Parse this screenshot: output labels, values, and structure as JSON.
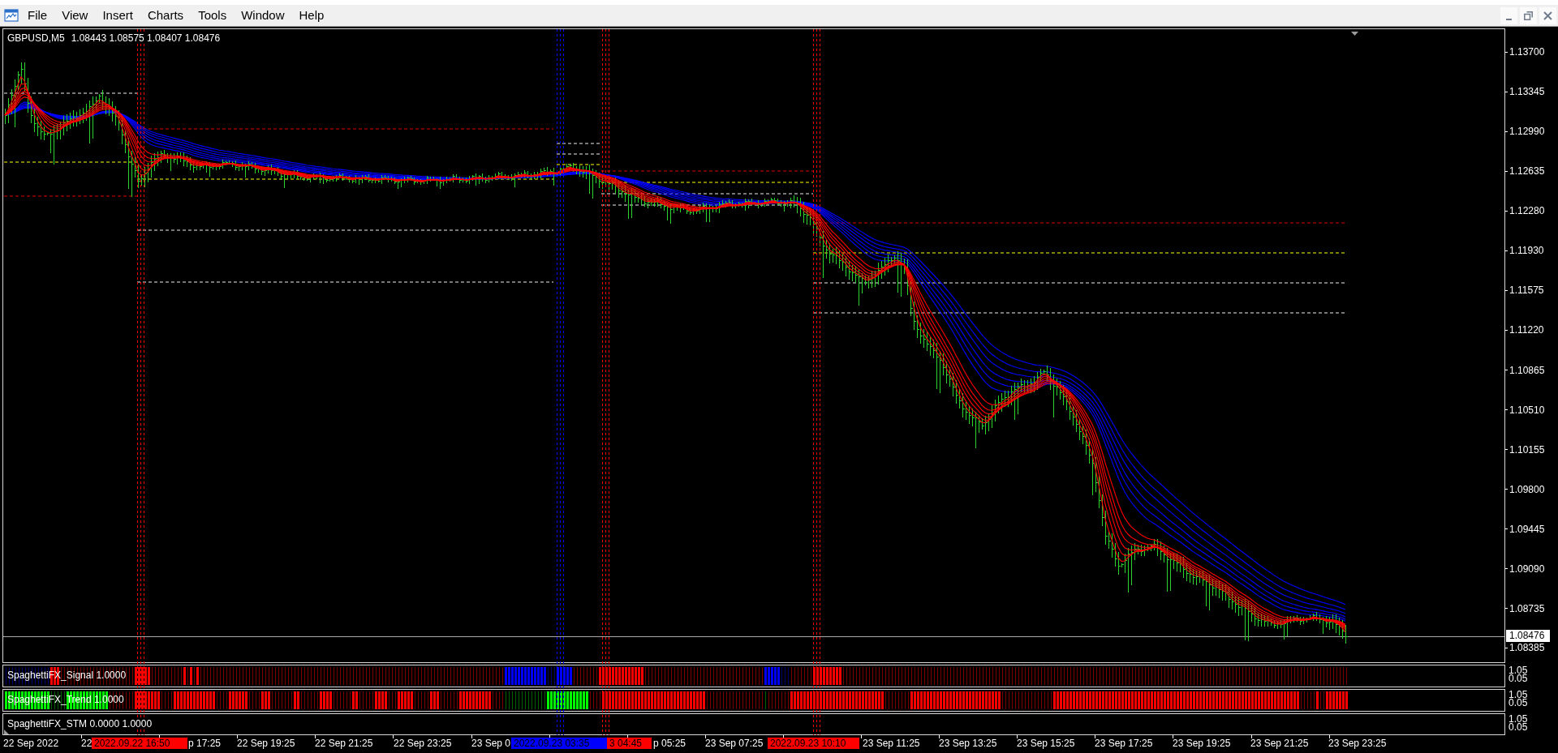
{
  "window": {
    "menu": [
      "File",
      "View",
      "Insert",
      "Charts",
      "Tools",
      "Window",
      "Help"
    ]
  },
  "chart": {
    "symbol": "GBPUSD,M5",
    "quote": "1.08443 1.08575 1.08407 1.08476"
  },
  "price_axis": {
    "ticks": [
      "1.13700",
      "1.13345",
      "1.12990",
      "1.12635",
      "1.12280",
      "1.11930",
      "1.11575",
      "1.11220",
      "1.10865",
      "1.10510",
      "1.10155",
      "1.09800",
      "1.09445",
      "1.09090",
      "1.08735"
    ],
    "current_price": "1.08476",
    "bottom_label": "1.08385"
  },
  "indicators": [
    {
      "kind": "signal",
      "label": "SpaghettiFX_Signal 1.0000",
      "scale": [
        "1.05",
        "0.05"
      ]
    },
    {
      "kind": "trend",
      "label": "SpaghettiFX_Trend 1.0000",
      "scale": [
        "1.05",
        "0.05"
      ]
    },
    {
      "kind": "empty",
      "label": "SpaghettiFX_STM 0.0000 1.0000",
      "scale": [
        "1.05",
        "0.05"
      ]
    }
  ],
  "time_axis": {
    "labels": [
      "22 Sep 2022",
      "22",
      "p 17:25",
      "22 Sep 19:25",
      "22 Sep 21:25",
      "22 Sep 23:25",
      "23 Sep 0",
      "p 05:25",
      "23 Sep 07:25",
      "23 Sep 11:25",
      "23 Sep 13:25",
      "23 Sep 15:25",
      "23 Sep 17:25",
      "23 Sep 19:25",
      "23 Sep 21:25",
      "23 Sep 23:25"
    ]
  },
  "time_markers": [
    {
      "text": "2022.09.22 16:50",
      "color": "#ff0000"
    },
    {
      "text": "2022.09.23 03:35",
      "color": "#0000ff"
    },
    {
      "text": "3 04:45",
      "color": "#ff0000"
    },
    {
      "text": "2022.09.23 10:10",
      "color": "#ff0000"
    }
  ]
}
